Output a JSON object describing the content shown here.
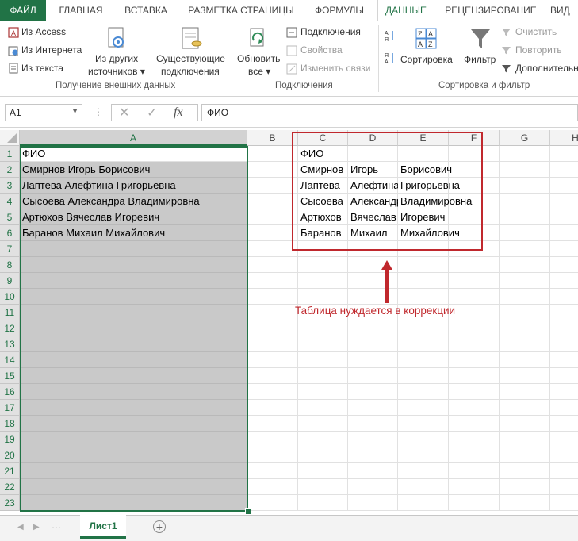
{
  "ribbon_tabs": [
    "ФАЙЛ",
    "ГЛАВНАЯ",
    "ВСТАВКА",
    "РАЗМЕТКА СТРАНИЦЫ",
    "ФОРМУЛЫ",
    "ДАННЫЕ",
    "РЕЦЕНЗИРОВАНИЕ",
    "ВИД"
  ],
  "ribbon": {
    "external": {
      "from_access": "Из Access",
      "from_web": "Из Интернета",
      "from_text": "Из текста",
      "from_other_line1": "Из других",
      "from_other_line2": "источников",
      "existing_line1": "Существующие",
      "existing_line2": "подключения",
      "group_label": "Получение внешних данных"
    },
    "connections": {
      "refresh_line1": "Обновить",
      "refresh_line2": "все",
      "connections": "Подключения",
      "properties": "Свойства",
      "edit_links": "Изменить связи",
      "group_label": "Подключения"
    },
    "sort_filter": {
      "sort": "Сортировка",
      "filter": "Фильтр",
      "clear": "Очистить",
      "reapply": "Повторить",
      "advanced": "Дополнительно",
      "group_label": "Сортировка и фильтр"
    }
  },
  "formula_bar": {
    "name_box": "A1",
    "fx": "fx",
    "content": "ФИО"
  },
  "columns": [
    "A",
    "B",
    "C",
    "D",
    "E",
    "F",
    "G",
    "H"
  ],
  "rows": [
    "1",
    "2",
    "3",
    "4",
    "5",
    "6",
    "7",
    "8",
    "9",
    "10",
    "11",
    "12",
    "13",
    "14",
    "15",
    "16",
    "17",
    "18",
    "19",
    "20",
    "21",
    "22",
    "23"
  ],
  "column_a": [
    "ФИО",
    "Смирнов Игорь Борисович",
    "Лаптева Алефтина Григорьевна",
    "Сысоева Александра Владимировна",
    "Артюхов Вячеслав Игоревич",
    "Баранов Михаил Михайлович"
  ],
  "split_table": {
    "c": [
      "ФИО",
      "Смирнов",
      "Лаптева",
      "Сысоева",
      "Артюхов",
      "Баранов"
    ],
    "d": [
      "",
      "Игорь",
      "Алефтина",
      "Александра",
      "Вячеслав",
      "Михаил"
    ],
    "e": [
      "",
      "Борисович",
      "Григорьевна",
      "Владимировна",
      "Игоревич",
      "Михайлович"
    ]
  },
  "annotation": {
    "text": "Таблица нуждается в коррекции",
    "color": "#c0282d"
  },
  "sheet_tab": "Лист1",
  "colors": {
    "accent": "#217346",
    "selection": "#c9c9c9"
  }
}
